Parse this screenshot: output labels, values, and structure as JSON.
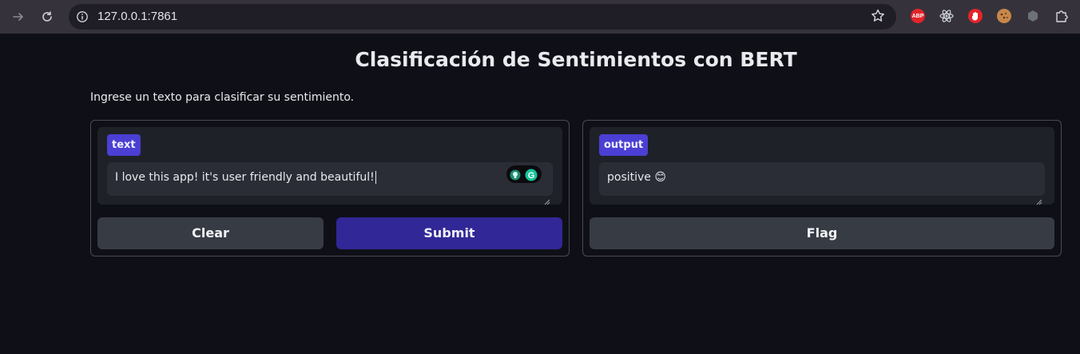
{
  "browser": {
    "url": "127.0.0.1:7861",
    "extensions": [
      {
        "name": "adblock-plus-icon",
        "label": "ABP",
        "color": "#e3242b"
      },
      {
        "name": "react-devtools-icon",
        "color": "#cfd3da"
      },
      {
        "name": "hand-stop-icon",
        "color": "#e3242b"
      },
      {
        "name": "cookie-icon",
        "color": "#c8874a"
      },
      {
        "name": "extension-hex-icon",
        "color": "#7c7f87"
      },
      {
        "name": "puzzle-icon",
        "color": "#d8d6de"
      }
    ]
  },
  "app": {
    "title": "Clasificación de Sentimientos con BERT",
    "description": "Ingrese un texto para clasificar su sentimiento.",
    "input_panel": {
      "label": "text",
      "value": "I love this app! it's user friendly and beautiful!",
      "clear_label": "Clear",
      "submit_label": "Submit"
    },
    "output_panel": {
      "label": "output",
      "value": "positive 😊",
      "flag_label": "Flag"
    }
  },
  "colors": {
    "accent": "#4b3fd4",
    "primary_button": "#312797",
    "secondary_button": "#373b44",
    "background": "#0f1017"
  }
}
